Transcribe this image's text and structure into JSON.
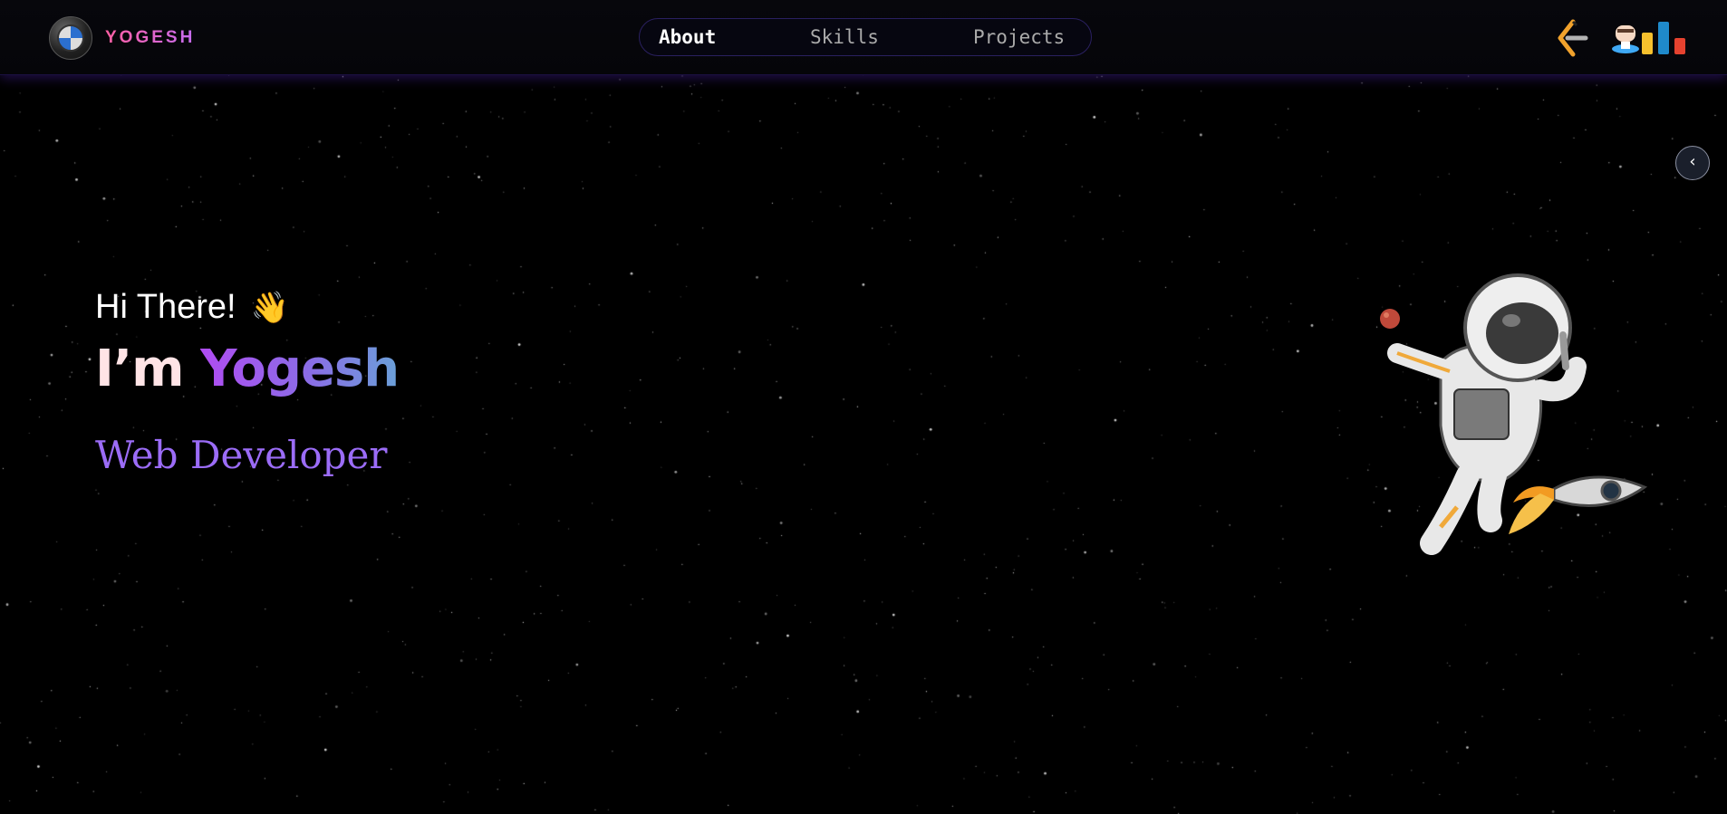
{
  "header": {
    "brand": "YOGESH",
    "logo_icon": "bmw-logo-icon",
    "nav": [
      {
        "label": "About",
        "active": true
      },
      {
        "label": "Skills",
        "active": false
      },
      {
        "label": "Projects",
        "active": false
      }
    ],
    "social_icons": [
      "leetcode-icon",
      "codechef-icon",
      "codeforces-icon"
    ]
  },
  "hero": {
    "greeting": "Hi There!",
    "wave_emoji": "👋",
    "title_prefix": "I’m",
    "name": "Yogesh",
    "role": "Web Developer"
  },
  "sidebar_toggle": {
    "icon": "chevron-left-icon",
    "glyph": "‹"
  },
  "illustration": "astronaut-illustration",
  "colors": {
    "background": "#000000",
    "brand_gradient": [
      "#ff5fa2",
      "#c56cf0"
    ],
    "name_gradient": [
      "#b04cf2",
      "#6aa0d8"
    ],
    "role": "#9b6cf7"
  }
}
